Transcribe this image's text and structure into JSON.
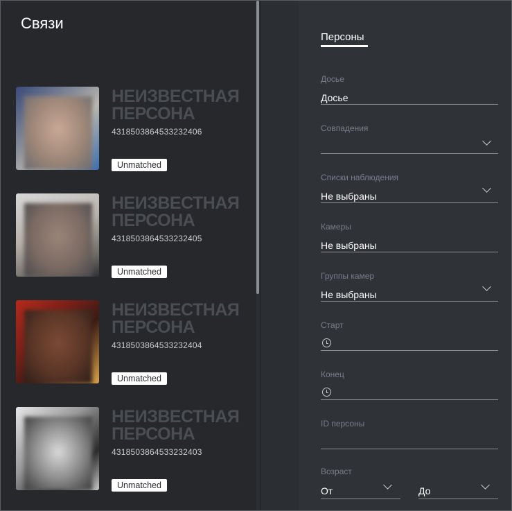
{
  "left_panel": {
    "title": "Связи",
    "cards": [
      {
        "name_watermark": "НЕИЗВЕСТНАЯ ПЕРСОНА",
        "id": "4318503864533232406",
        "badge": "Unmatched"
      },
      {
        "name_watermark": "НЕИЗВЕСТНАЯ ПЕРСОНА",
        "id": "4318503864533232405",
        "badge": "Unmatched"
      },
      {
        "name_watermark": "НЕИЗВЕСТНАЯ ПЕРСОНА",
        "id": "4318503864533232404",
        "badge": "Unmatched"
      },
      {
        "name_watermark": "НЕИЗВЕСТНАЯ ПЕРСОНА",
        "id": "4318503864533232403",
        "badge": "Unmatched"
      }
    ]
  },
  "filters": {
    "tab": "Персоны",
    "dossier": {
      "label": "Досье",
      "value": "Досье"
    },
    "matches": {
      "label": "Совпадения",
      "value": ""
    },
    "watch_lists": {
      "label": "Списки наблюдения",
      "value": "Не выбраны"
    },
    "cameras": {
      "label": "Камеры",
      "value": "Не выбраны"
    },
    "camera_groups": {
      "label": "Группы камер",
      "value": "Не выбраны"
    },
    "start": {
      "label": "Старт",
      "value": ""
    },
    "end": {
      "label": "Конец",
      "value": ""
    },
    "person_id": {
      "label": "ID персоны",
      "value": ""
    },
    "age": {
      "label": "Возраст",
      "from": "От",
      "to": "До"
    }
  },
  "icons": {
    "chevron": "chevron-down-icon",
    "clock": "clock-icon",
    "collapse": "chevron-right-icon"
  }
}
